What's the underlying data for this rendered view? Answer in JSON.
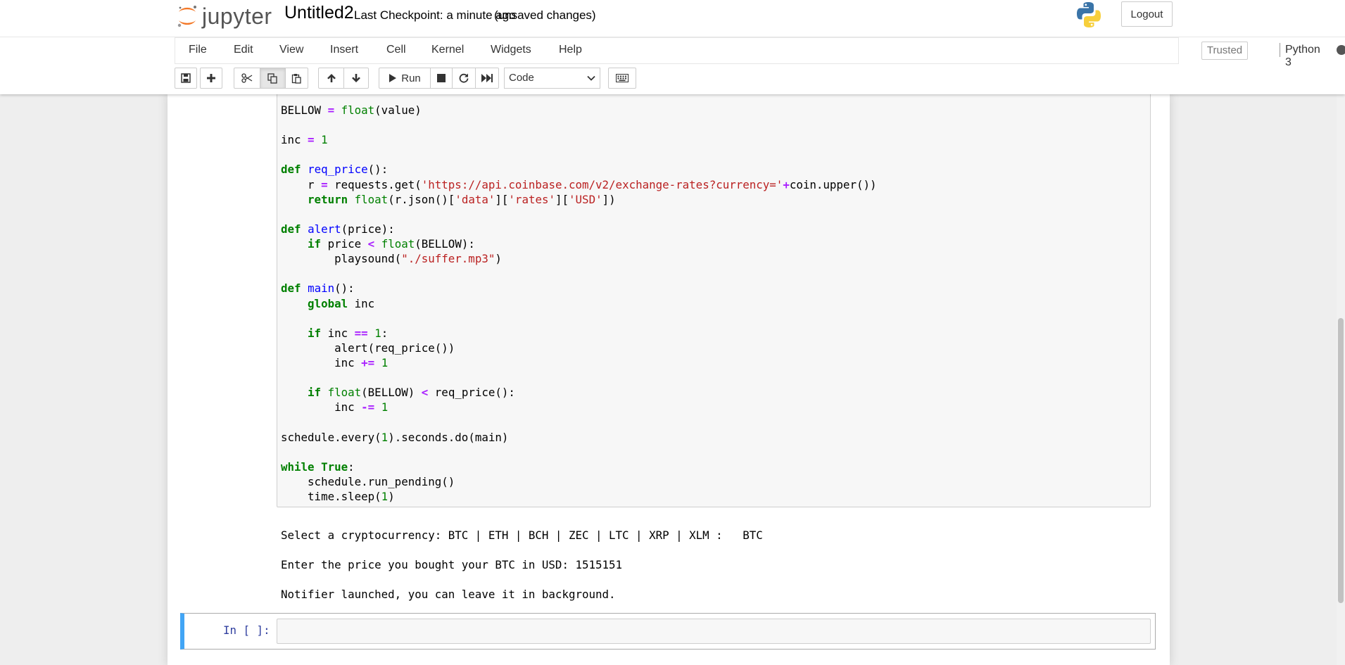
{
  "header": {
    "logo_text": "jupyter",
    "notebook_name": "Untitled2",
    "checkpoint": "Last Checkpoint: a minute ago",
    "unsaved": "(unsaved changes)",
    "logout_label": "Logout"
  },
  "menubar": {
    "items": [
      "File",
      "Edit",
      "View",
      "Insert",
      "Cell",
      "Kernel",
      "Widgets",
      "Help"
    ],
    "trusted": "Trusted",
    "kernel_name": "Python 3"
  },
  "toolbar": {
    "run_label": "Run",
    "cell_type": "Code"
  },
  "code_cell": {
    "lines": [
      "BELLOW = float(value)",
      "",
      "inc = 1",
      "",
      "def req_price():",
      "    r = requests.get('https://api.coinbase.com/v2/exchange-rates?currency='+coin.upper())",
      "    return float(r.json()['data']['rates']['USD'])",
      "",
      "def alert(price):",
      "    if price < float(BELLOW):",
      "        playsound(\"./suffer.mp3\")",
      "",
      "def main():",
      "    global inc",
      "",
      "    if inc == 1:",
      "        alert(req_price())",
      "        inc += 1",
      "",
      "    if float(BELLOW) < req_price():",
      "        inc -= 1",
      "",
      "schedule.every(1).seconds.do(main)",
      "",
      "while True:",
      "    schedule.run_pending()",
      "    time.sleep(1)"
    ]
  },
  "output": {
    "lines": [
      "Select a cryptocurrency: BTC | ETH | BCH | ZEC | LTC | XRP | XLM :   BTC",
      "Enter the price you bought your BTC in USD: 1515151",
      "Notifier launched, you can leave it in background."
    ]
  },
  "empty_cell": {
    "prompt": "In [ ]:"
  },
  "colors": {
    "keyword": "#008000",
    "operator": "#aa22ff",
    "string": "#ba2121",
    "function_def": "#0000ff",
    "selected_cell_border": "#42a5f5",
    "prompt": "#303f9f"
  }
}
